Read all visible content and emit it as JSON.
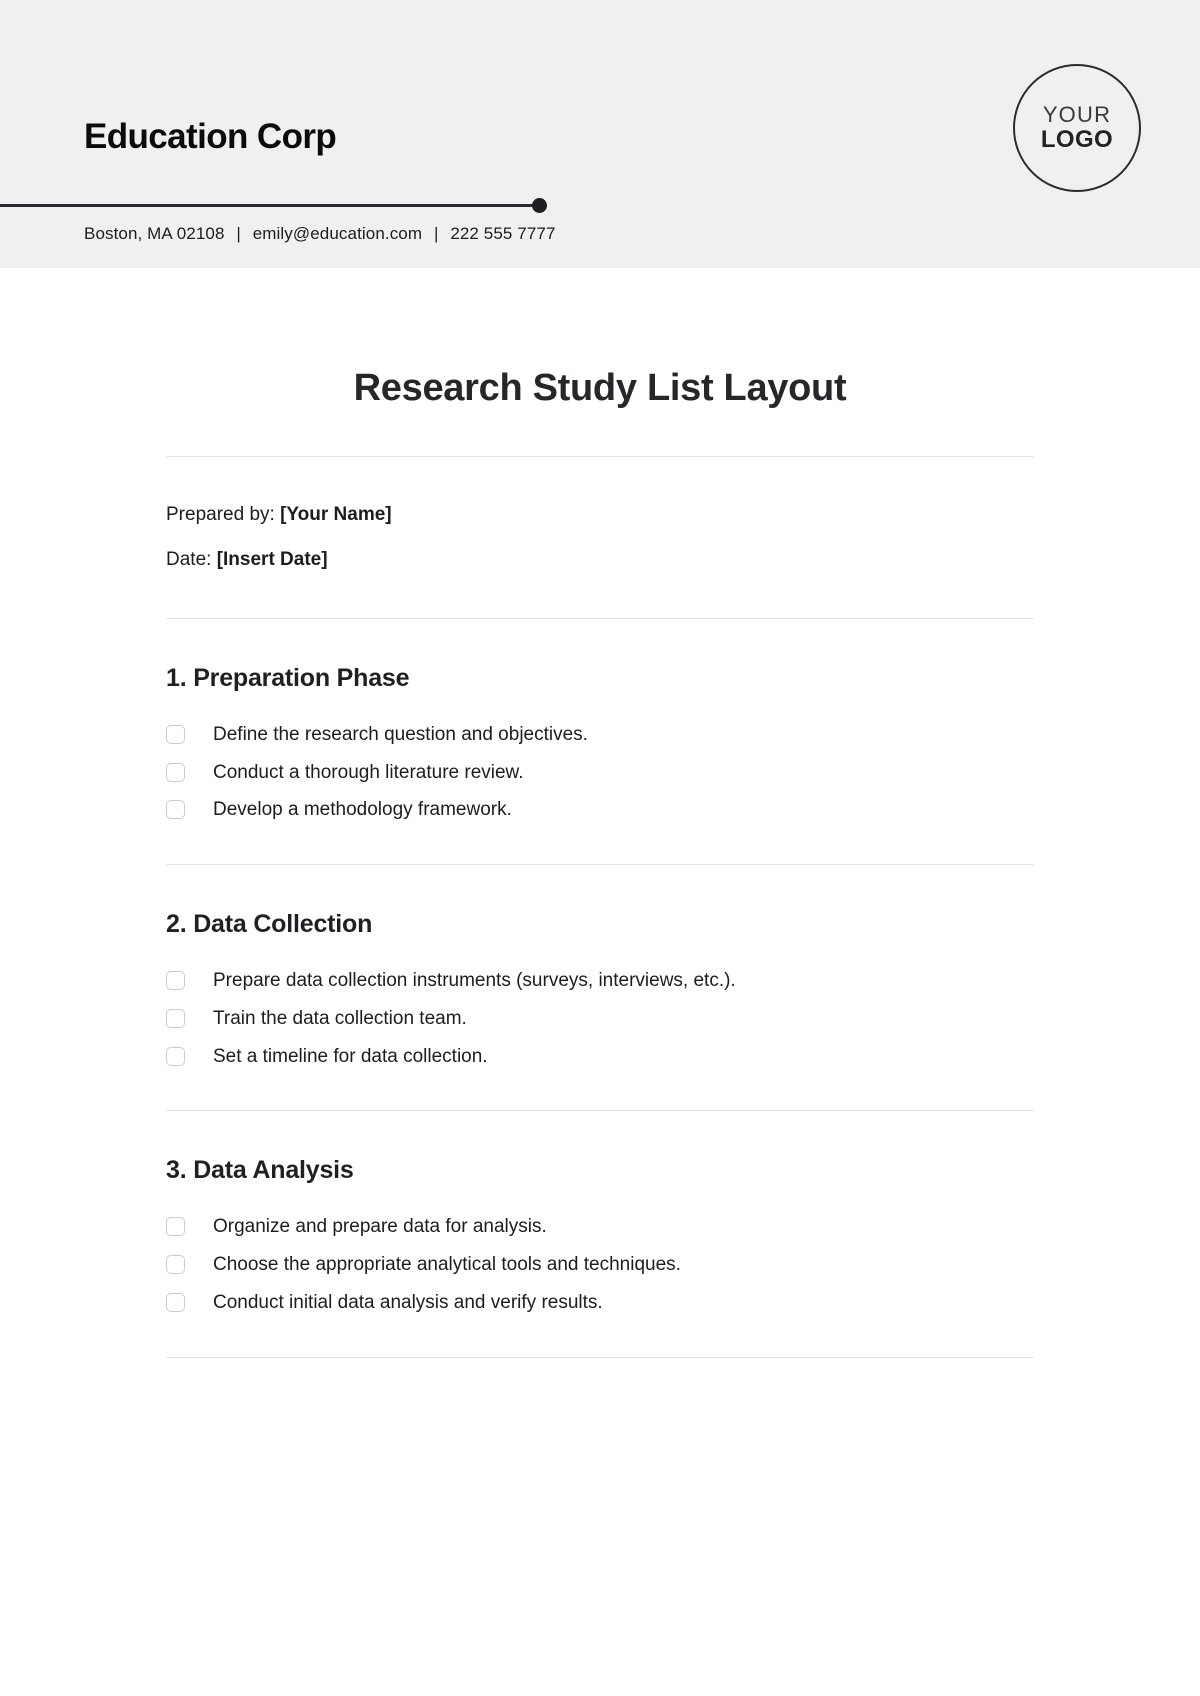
{
  "header": {
    "company_name": "Education Corp",
    "contact": {
      "address": "Boston, MA 02108",
      "email": "emily@education.com",
      "phone": "222 555 7777",
      "separator": "|"
    },
    "logo": {
      "line1": "YOUR",
      "line2": "LOGO"
    },
    "background_color": "#f0f0f0",
    "rule_color": "#2a2a2e"
  },
  "document": {
    "title": "Research Study List Layout",
    "meta": [
      {
        "label": "Prepared by:",
        "value": "[Your Name]"
      },
      {
        "label": "Date:",
        "value": "[Insert Date]"
      }
    ],
    "sections": [
      {
        "heading": "1. Preparation Phase",
        "items": [
          "Define the research question and objectives.",
          "Conduct a thorough literature review.",
          "Develop a methodology framework."
        ]
      },
      {
        "heading": "2. Data Collection",
        "items": [
          "Prepare data collection instruments (surveys, interviews, etc.).",
          "Train the data collection team.",
          "Set a timeline for data collection."
        ]
      },
      {
        "heading": "3. Data Analysis",
        "items": [
          "Organize and prepare data for analysis.",
          "Choose the appropriate analytical tools and techniques.",
          "Conduct initial data analysis and verify results."
        ]
      }
    ]
  }
}
